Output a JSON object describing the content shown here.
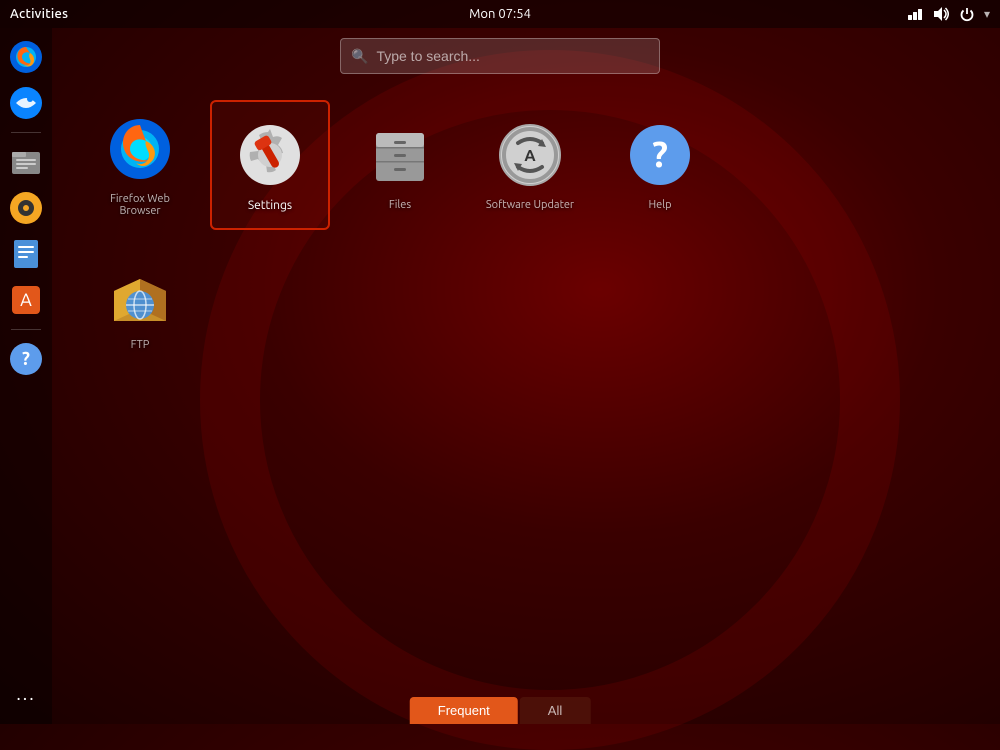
{
  "topbar": {
    "activities_label": "Activities",
    "clock": "Mon 07:54"
  },
  "search": {
    "placeholder": "Type to search..."
  },
  "apps": {
    "row1": [
      {
        "id": "firefox",
        "label": "Firefox",
        "selected": false
      },
      {
        "id": "settings",
        "label": "Settings",
        "selected": true
      },
      {
        "id": "filemanager",
        "label": "Files",
        "selected": false
      },
      {
        "id": "updater",
        "label": "Software Updater",
        "selected": false
      },
      {
        "id": "help",
        "label": "Help",
        "selected": false
      }
    ],
    "row2": [
      {
        "id": "ftp",
        "label": "FTP",
        "selected": false
      }
    ]
  },
  "tabs": {
    "frequent": "Frequent",
    "all": "All"
  },
  "dock": {
    "items": [
      {
        "id": "firefox",
        "label": "Firefox"
      },
      {
        "id": "thunderbird",
        "label": "Thunderbird"
      },
      {
        "id": "files",
        "label": "Files"
      },
      {
        "id": "rhythmbox",
        "label": "Rhythmbox"
      },
      {
        "id": "writer",
        "label": "LibreOffice Writer"
      },
      {
        "id": "appstore",
        "label": "App Store"
      },
      {
        "id": "help",
        "label": "Help"
      }
    ]
  }
}
